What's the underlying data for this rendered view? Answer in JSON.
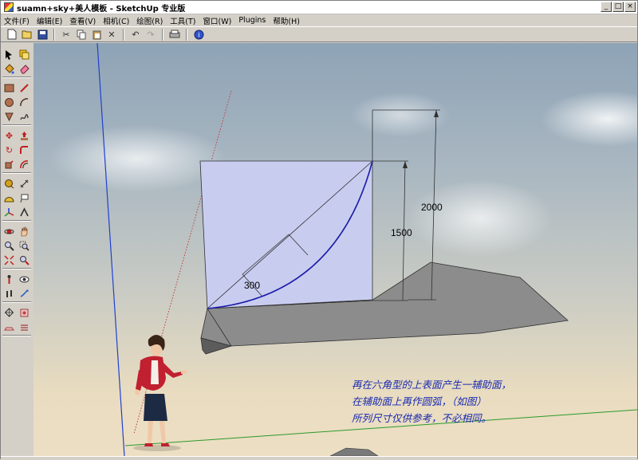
{
  "window": {
    "title": "suamn+sky+美人模板 - SketchUp 专业版",
    "controls": [
      "_",
      "□",
      "×"
    ]
  },
  "menu": [
    "文件(F)",
    "编辑(E)",
    "查看(V)",
    "相机(C)",
    "绘图(R)",
    "工具(T)",
    "窗口(W)",
    "Plugins",
    "帮助(H)"
  ],
  "toolbar_icons": [
    "new-file-icon",
    "open-file-icon",
    "save-icon",
    "cut-icon",
    "copy-icon",
    "paste-icon",
    "erase-icon",
    "undo-icon",
    "redo-icon",
    "print-icon",
    "model-info-icon"
  ],
  "palette_icons": [
    "select-icon",
    "make-component-icon",
    "paint-bucket-icon",
    "eraser-icon",
    "rectangle-icon",
    "line-icon",
    "circle-icon",
    "arc-icon",
    "polygon-icon",
    "freehand-icon",
    "move-icon",
    "push-pull-icon",
    "rotate-icon",
    "follow-me-icon",
    "scale-icon",
    "offset-icon",
    "tape-measure-icon",
    "dimension-icon",
    "protractor-icon",
    "text-icon",
    "axes-icon",
    "3d-text-icon",
    "orbit-icon",
    "pan-icon",
    "zoom-icon",
    "zoom-window-icon",
    "zoom-extents-icon",
    "previous-view-icon",
    "position-camera-icon",
    "look-around-icon",
    "walk-icon",
    "section-plane-icon",
    "sandbox-icon",
    "smoove-icon",
    "stamp-icon",
    "drape-icon"
  ],
  "dimensions": {
    "height_total": "2000",
    "height_face": "1500",
    "arc_offset": "300"
  },
  "annotation": [
    "再在六角型的上表面产生一辅助面，",
    "在辅助面上再作圆弧，（如图）",
    "所列尺寸仅供参考，不必相同。"
  ],
  "colors": {
    "face_fill": "#c8cdf0",
    "arc_stroke": "#1c1ca8",
    "shadow_fill": "#8a8a8a",
    "annotation_text": "#1a2ab0",
    "axis_blue": "#2040d0",
    "axis_green": "#2a9a2a",
    "axis_red": "#c04040"
  }
}
